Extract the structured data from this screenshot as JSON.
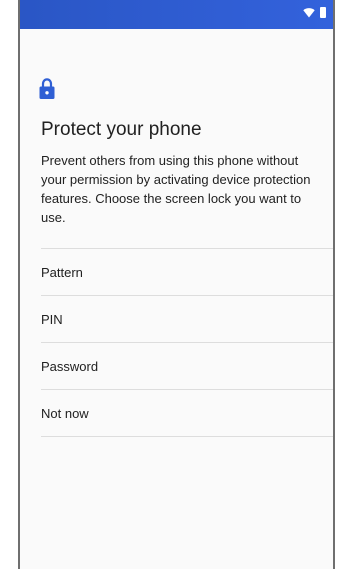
{
  "status_bar": {
    "wifi_icon": "wifi-icon",
    "battery_icon": "battery-icon",
    "color": "#2f5fd4"
  },
  "screen": {
    "lock_icon": "lock-icon",
    "lock_icon_color": "#2f5fd4",
    "title": "Protect your phone",
    "description": "Prevent others from using this phone without your permission by activating device protection features. Choose the screen lock you want to use.",
    "options": [
      {
        "label": "Pattern"
      },
      {
        "label": "PIN"
      },
      {
        "label": "Password"
      },
      {
        "label": "Not now"
      }
    ]
  }
}
